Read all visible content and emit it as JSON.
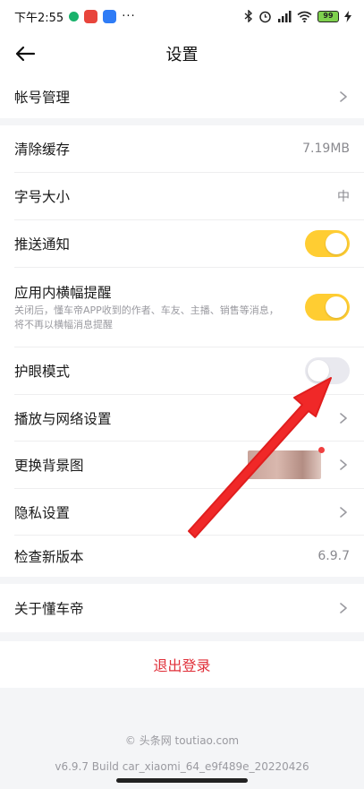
{
  "status_bar": {
    "time": "下午2:55",
    "dots": "···",
    "battery": "99",
    "colors": {
      "app1": "#e8453c",
      "app2": "#2f7cf6",
      "dot1": "#19b26b"
    }
  },
  "header": {
    "title": "设置",
    "back_icon": "arrow-left-icon"
  },
  "sections": {
    "account": {
      "label": "帐号管理"
    },
    "cache": {
      "label": "清除缓存",
      "value": "7.19MB"
    },
    "font": {
      "label": "字号大小",
      "value": "中"
    },
    "push": {
      "label": "推送通知",
      "toggle": "on"
    },
    "banner": {
      "label": "应用内横幅提醒",
      "sub1": "关闭后，懂车帝APP收到的作者、车友、主播、销售等消息，",
      "sub2": "将不再以横幅消息提醒",
      "toggle": "on"
    },
    "eyecare": {
      "label": "护眼模式",
      "toggle": "off"
    },
    "network": {
      "label": "播放与网络设置"
    },
    "background": {
      "label": "更换背景图"
    },
    "privacy": {
      "label": "隐私设置"
    },
    "version": {
      "label": "检查新版本",
      "value": "6.9.7"
    },
    "about": {
      "label": "关于懂车帝"
    }
  },
  "logout": {
    "label": "退出登录"
  },
  "footer": {
    "line1": "© 头条网 toutiao.com",
    "line2": "v6.9.7 Build car_xiaomi_64_e9f489e_20220426"
  },
  "colors": {
    "toggle_on": "#ffcd32",
    "toggle_off": "#e9e9ef",
    "logout": "#e0303a",
    "annotation_arrow": "#f02828"
  }
}
